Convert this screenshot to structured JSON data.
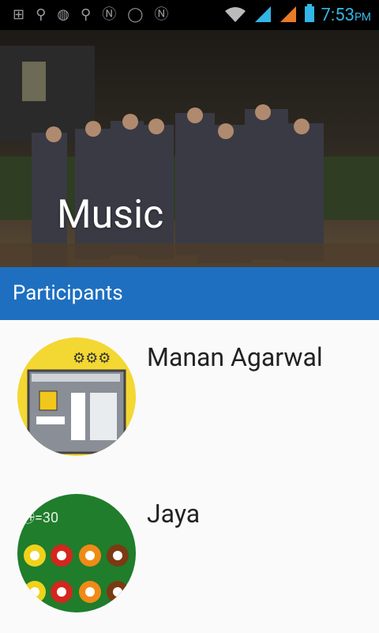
{
  "status_bar": {
    "time": "7:53",
    "ampm": "PM",
    "notification_icons": [
      "plus-icon",
      "usb-icon",
      "android-icon",
      "usb-icon",
      "n-icon",
      "whatsapp-icon",
      "n-icon"
    ],
    "system_icons": [
      "wifi-icon",
      "signal-1-icon",
      "signal-2-icon",
      "battery-icon"
    ],
    "accent_color": "#33b5e5"
  },
  "hero": {
    "title": "Music"
  },
  "section": {
    "title": "Participants",
    "color": "#1e6fc0"
  },
  "participants": [
    {
      "name": "Manan Agarwal"
    },
    {
      "name": "Jaya"
    }
  ]
}
